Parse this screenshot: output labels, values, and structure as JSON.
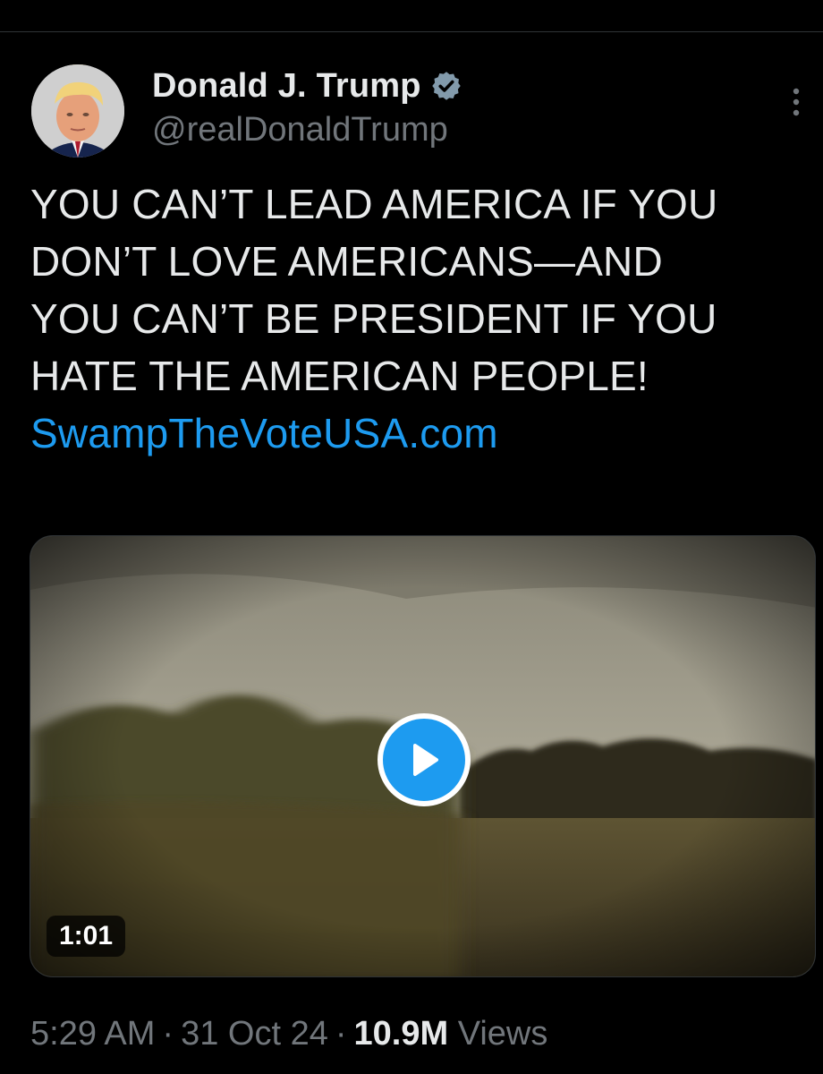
{
  "author": {
    "display_name": "Donald J. Trump",
    "handle": "@realDonaldTrump",
    "verified_icon": "verified-badge-icon"
  },
  "tweet": {
    "text_lines": [
      "YOU CAN’T LEAD AMERICA IF YOU",
      "DON’T LOVE AMERICANS—AND",
      "YOU CAN’T BE PRESIDENT IF YOU",
      "HATE THE AMERICAN PEOPLE!"
    ],
    "link_text": "SwampTheVoteUSA.com"
  },
  "media": {
    "duration": "1:01",
    "play_icon": "play-icon"
  },
  "meta": {
    "time": "5:29 AM",
    "separator": "·",
    "date": "31 Oct 24",
    "views_count": "10.9M",
    "views_label": "Views"
  },
  "colors": {
    "background": "#000000",
    "text": "#e7e9ea",
    "secondary_text": "#71767b",
    "link": "#1d9bf0",
    "verified": "#829aab"
  }
}
